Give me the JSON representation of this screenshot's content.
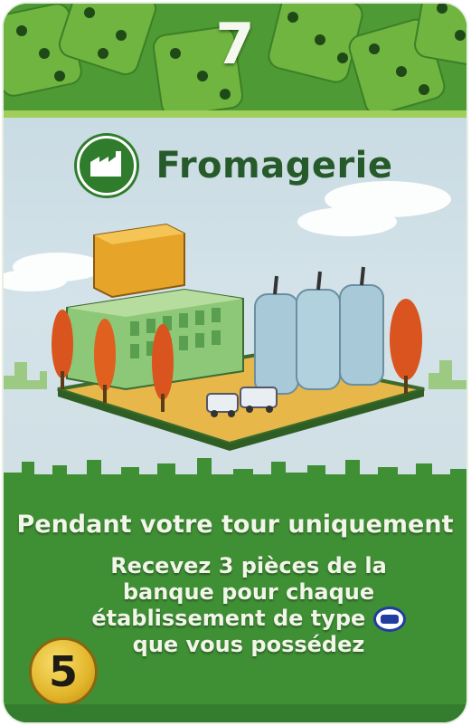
{
  "card": {
    "activation": "7",
    "title": "Fromagerie",
    "type_icon": "factory-icon",
    "ability_heading": "Pendant votre tour uniquement",
    "ability_text": "Recevez 3 pièces de la banque pour chaque établissement de type",
    "ability_text_end": "que vous possédez",
    "inline_icon": "cow-ranch-icon",
    "cost": "5"
  },
  "colors": {
    "card_green": "#3f8f35",
    "sky": "#cfdfe4",
    "title_green": "#275a2a",
    "coin_gold": "#e2b52a",
    "icon_blue": "#1f3ea0"
  }
}
